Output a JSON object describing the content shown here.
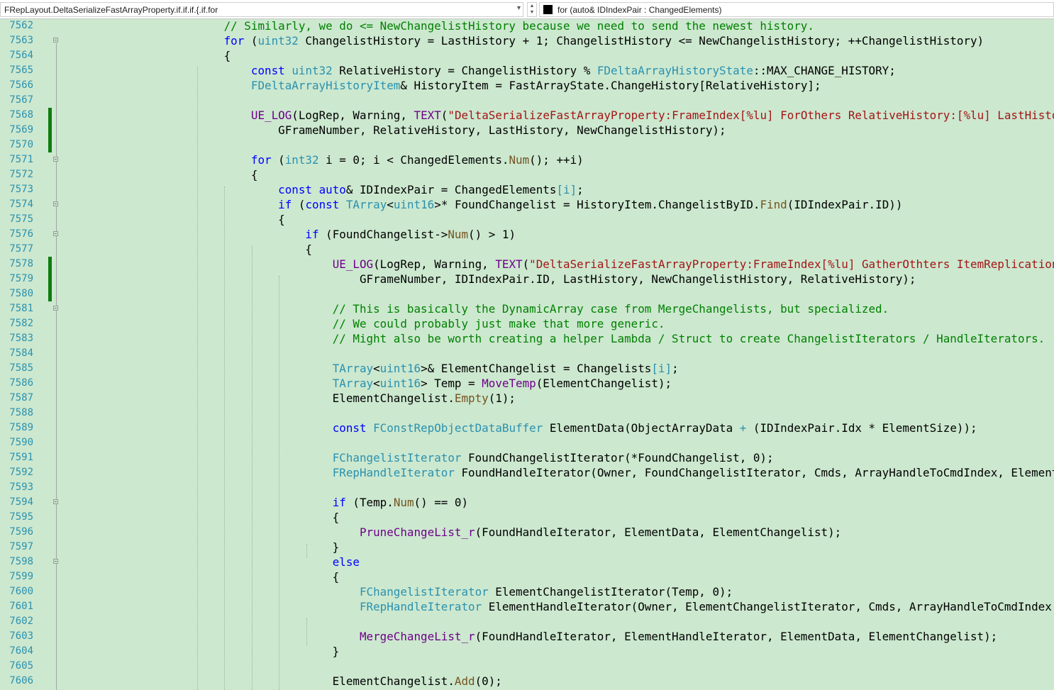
{
  "navigation_bar": {
    "scope_dropdown": {
      "value": "FRepLayout.DeltaSerializeFastArrayProperty.if.if.if.{.if.for",
      "chevron": "chevron-down-icon"
    },
    "member_dropdown": {
      "value": "for (auto& IDIndexPair : ChangedElements)",
      "chevron": "chevron-down-icon"
    },
    "split_spinner_icon": "spinner-icon"
  },
  "colors": {
    "background": "#cce8cf",
    "line_number": "#2b91af",
    "keyword": "#0000ff",
    "type": "#2b91af",
    "comment": "#008000",
    "string": "#a31515",
    "macro": "#6f008a",
    "function": "#74531f",
    "change_marker": "#107c10"
  },
  "editor": {
    "lines": [
      {
        "number": "7562",
        "tokens": [
          [
            "",
            "                        "
          ],
          [
            "comment",
            "// Similarly, we do <= NewChangelistHistory because we need to send the newest history."
          ]
        ]
      },
      {
        "number": "7563",
        "fold": true,
        "tokens": [
          [
            "",
            "                        "
          ],
          [
            "keyword",
            "for"
          ],
          [
            "",
            " ("
          ],
          [
            "type",
            "uint32"
          ],
          [
            "",
            " ChangelistHistory = LastHistory + 1; ChangelistHistory <= NewChangelistHistory; ++ChangelistHistory)"
          ]
        ]
      },
      {
        "number": "7564",
        "tokens": [
          [
            "",
            "                        {"
          ]
        ]
      },
      {
        "number": "7565",
        "tokens": [
          [
            "",
            "                            "
          ],
          [
            "keyword",
            "const"
          ],
          [
            "",
            " "
          ],
          [
            "type",
            "uint32"
          ],
          [
            "",
            " RelativeHistory = ChangelistHistory % "
          ],
          [
            "type",
            "FDeltaArrayHistoryState"
          ],
          [
            "",
            "::MAX_CHANGE_HISTORY;"
          ]
        ]
      },
      {
        "number": "7566",
        "tokens": [
          [
            "",
            "                            "
          ],
          [
            "type",
            "FDeltaArrayHistoryItem"
          ],
          [
            "",
            "& HistoryItem = FastArrayState.ChangeHistory[RelativeHistory];"
          ]
        ]
      },
      {
        "number": "7567",
        "tokens": []
      },
      {
        "number": "7568",
        "changed": true,
        "tokens": [
          [
            "",
            "                            "
          ],
          [
            "macro",
            "UE_LOG"
          ],
          [
            "",
            "(LogRep, Warning, "
          ],
          [
            "macro",
            "TEXT"
          ],
          [
            "",
            "("
          ],
          [
            "string",
            "\"DeltaSerializeFastArrayProperty:FrameIndex[%lu] ForOthers RelativeHistory:[%lu] LastHistory["
          ]
        ]
      },
      {
        "number": "7569",
        "changed": true,
        "tokens": [
          [
            "",
            "                                GFrameNumber, RelativeHistory, LastHistory, NewChangelistHistory);"
          ]
        ]
      },
      {
        "number": "7570",
        "changed": true,
        "tokens": []
      },
      {
        "number": "7571",
        "fold": true,
        "tokens": [
          [
            "",
            "                            "
          ],
          [
            "keyword",
            "for"
          ],
          [
            "",
            " ("
          ],
          [
            "type",
            "int32"
          ],
          [
            "",
            " i = 0; i < ChangedElements."
          ],
          [
            "function",
            "Num"
          ],
          [
            "",
            "(); ++i)"
          ]
        ]
      },
      {
        "number": "7572",
        "tokens": [
          [
            "",
            "                            {"
          ]
        ]
      },
      {
        "number": "7573",
        "tokens": [
          [
            "",
            "                                "
          ],
          [
            "keyword",
            "const"
          ],
          [
            "",
            " "
          ],
          [
            "keyword",
            "auto"
          ],
          [
            "",
            "& IDIndexPair = ChangedElements"
          ],
          [
            "type",
            "[i]"
          ],
          [
            "",
            ";"
          ]
        ]
      },
      {
        "number": "7574",
        "fold": true,
        "tokens": [
          [
            "",
            "                                "
          ],
          [
            "keyword",
            "if"
          ],
          [
            "",
            " ("
          ],
          [
            "keyword",
            "const"
          ],
          [
            "",
            " "
          ],
          [
            "type",
            "TArray"
          ],
          [
            "",
            "<"
          ],
          [
            "type",
            "uint16"
          ],
          [
            "",
            ">* FoundChangelist = HistoryItem.ChangelistByID."
          ],
          [
            "function",
            "Find"
          ],
          [
            "",
            "(IDIndexPair.ID))"
          ]
        ]
      },
      {
        "number": "7575",
        "tokens": [
          [
            "",
            "                                {"
          ]
        ]
      },
      {
        "number": "7576",
        "fold": true,
        "tokens": [
          [
            "",
            "                                    "
          ],
          [
            "keyword",
            "if"
          ],
          [
            "",
            " (FoundChangelist->"
          ],
          [
            "function",
            "Num"
          ],
          [
            "",
            "() > 1)"
          ]
        ]
      },
      {
        "number": "7577",
        "tokens": [
          [
            "",
            "                                    {"
          ]
        ]
      },
      {
        "number": "7578",
        "changed": true,
        "tokens": [
          [
            "",
            "                                        "
          ],
          [
            "macro",
            "UE_LOG"
          ],
          [
            "",
            "(LogRep, Warning, "
          ],
          [
            "macro",
            "TEXT"
          ],
          [
            "",
            "("
          ],
          [
            "string",
            "\"DeltaSerializeFastArrayProperty:FrameIndex[%lu] GatherOthters ItemReplicationID:"
          ]
        ]
      },
      {
        "number": "7579",
        "changed": true,
        "tokens": [
          [
            "",
            "                                            GFrameNumber, IDIndexPair.ID, LastHistory, NewChangelistHistory, RelativeHistory);"
          ]
        ]
      },
      {
        "number": "7580",
        "changed": true,
        "tokens": []
      },
      {
        "number": "7581",
        "fold": true,
        "tokens": [
          [
            "",
            "                                        "
          ],
          [
            "comment",
            "// This is basically the DynamicArray case from MergeChangelists, but specialized."
          ]
        ]
      },
      {
        "number": "7582",
        "tokens": [
          [
            "",
            "                                        "
          ],
          [
            "comment",
            "// We could probably just make that more generic."
          ]
        ]
      },
      {
        "number": "7583",
        "tokens": [
          [
            "",
            "                                        "
          ],
          [
            "comment",
            "// Might also be worth creating a helper Lambda / Struct to create ChangelistIterators / HandleIterators."
          ]
        ]
      },
      {
        "number": "7584",
        "tokens": []
      },
      {
        "number": "7585",
        "tokens": [
          [
            "",
            "                                        "
          ],
          [
            "type",
            "TArray"
          ],
          [
            "",
            "<"
          ],
          [
            "type",
            "uint16"
          ],
          [
            "",
            ">& ElementChangelist = Changelists"
          ],
          [
            "type",
            "[i]"
          ],
          [
            "",
            ";"
          ]
        ]
      },
      {
        "number": "7586",
        "tokens": [
          [
            "",
            "                                        "
          ],
          [
            "type",
            "TArray"
          ],
          [
            "",
            "<"
          ],
          [
            "type",
            "uint16"
          ],
          [
            "",
            "> Temp = "
          ],
          [
            "macro",
            "MoveTemp"
          ],
          [
            "",
            "(ElementChangelist);"
          ]
        ]
      },
      {
        "number": "7587",
        "tokens": [
          [
            "",
            "                                        ElementChangelist."
          ],
          [
            "function",
            "Empty"
          ],
          [
            "",
            "(1);"
          ]
        ]
      },
      {
        "number": "7588",
        "tokens": []
      },
      {
        "number": "7589",
        "tokens": [
          [
            "",
            "                                        "
          ],
          [
            "keyword",
            "const"
          ],
          [
            "",
            " "
          ],
          [
            "type",
            "FConstRepObjectDataBuffer"
          ],
          [
            "",
            " ElementData(ObjectArrayData "
          ],
          [
            "type",
            "+"
          ],
          [
            "",
            " (IDIndexPair.Idx * ElementSize));"
          ]
        ]
      },
      {
        "number": "7590",
        "tokens": []
      },
      {
        "number": "7591",
        "tokens": [
          [
            "",
            "                                        "
          ],
          [
            "type",
            "FChangelistIterator"
          ],
          [
            "",
            " FoundChangelistIterator(*FoundChangelist, 0);"
          ]
        ]
      },
      {
        "number": "7592",
        "tokens": [
          [
            "",
            "                                        "
          ],
          [
            "type",
            "FRepHandleIterator"
          ],
          [
            "",
            " FoundHandleIterator(Owner, FoundChangelistIterator, Cmds, ArrayHandleToCmdIndex, ElementSiz"
          ]
        ]
      },
      {
        "number": "7593",
        "tokens": []
      },
      {
        "number": "7594",
        "fold": true,
        "tokens": [
          [
            "",
            "                                        "
          ],
          [
            "keyword",
            "if"
          ],
          [
            "",
            " (Temp."
          ],
          [
            "function",
            "Num"
          ],
          [
            "",
            "() == 0)"
          ]
        ]
      },
      {
        "number": "7595",
        "tokens": [
          [
            "",
            "                                        {"
          ]
        ]
      },
      {
        "number": "7596",
        "tokens": [
          [
            "",
            "                                            "
          ],
          [
            "macro",
            "PruneChangeList_r"
          ],
          [
            "",
            "(FoundHandleIterator, ElementData, ElementChangelist);"
          ]
        ]
      },
      {
        "number": "7597",
        "tokens": [
          [
            "",
            "                                        }"
          ]
        ]
      },
      {
        "number": "7598",
        "fold": true,
        "tokens": [
          [
            "",
            "                                        "
          ],
          [
            "keyword",
            "else"
          ]
        ]
      },
      {
        "number": "7599",
        "tokens": [
          [
            "",
            "                                        {"
          ]
        ]
      },
      {
        "number": "7600",
        "tokens": [
          [
            "",
            "                                            "
          ],
          [
            "type",
            "FChangelistIterator"
          ],
          [
            "",
            " ElementChangelistIterator(Temp, 0);"
          ]
        ]
      },
      {
        "number": "7601",
        "tokens": [
          [
            "",
            "                                            "
          ],
          [
            "type",
            "FRepHandleIterator"
          ],
          [
            "",
            " ElementHandleIterator(Owner, ElementChangelistIterator, Cmds, ArrayHandleToCmdIndex, El"
          ]
        ]
      },
      {
        "number": "7602",
        "tokens": []
      },
      {
        "number": "7603",
        "tokens": [
          [
            "",
            "                                            "
          ],
          [
            "macro",
            "MergeChangeList_r"
          ],
          [
            "",
            "(FoundHandleIterator, ElementHandleIterator, ElementData, ElementChangelist);"
          ]
        ]
      },
      {
        "number": "7604",
        "tokens": [
          [
            "",
            "                                        }"
          ]
        ]
      },
      {
        "number": "7605",
        "tokens": []
      },
      {
        "number": "7606",
        "tokens": [
          [
            "",
            "                                        ElementChangelist."
          ],
          [
            "function",
            "Add"
          ],
          [
            "",
            "(0);"
          ]
        ]
      }
    ]
  }
}
